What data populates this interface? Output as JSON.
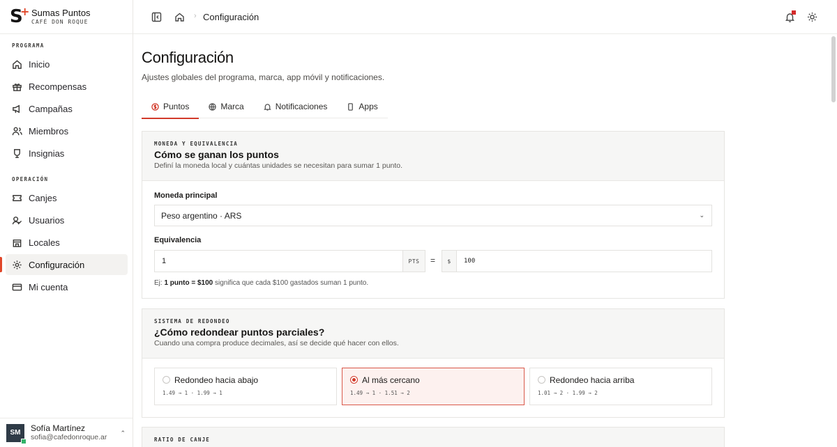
{
  "brand": {
    "name": "Sumas Puntos",
    "subtitle": "CAFÉ DON ROQUE"
  },
  "sidebar": {
    "sections": [
      {
        "label": "PROGRAMA"
      },
      {
        "label": "OPERACIÓN"
      }
    ],
    "items": [
      {
        "label": "Inicio",
        "icon": "home-icon"
      },
      {
        "label": "Recompensas",
        "icon": "gift-icon"
      },
      {
        "label": "Campañas",
        "icon": "megaphone-icon"
      },
      {
        "label": "Miembros",
        "icon": "members-icon"
      },
      {
        "label": "Insignias",
        "icon": "badge-icon"
      },
      {
        "label": "Canjes",
        "icon": "ticket-icon"
      },
      {
        "label": "Usuarios",
        "icon": "users-icon"
      },
      {
        "label": "Locales",
        "icon": "store-icon"
      },
      {
        "label": "Configuración",
        "icon": "gear-icon",
        "active": true
      },
      {
        "label": "Mi cuenta",
        "icon": "card-icon"
      }
    ]
  },
  "user": {
    "initials": "SM",
    "name": "Sofía Martínez",
    "email": "sofia@cafedonroque.ar"
  },
  "topbar": {
    "breadcrumb_current": "Configuración"
  },
  "page": {
    "title": "Configuración",
    "subtitle": "Ajustes globales del programa, marca, app móvil y notificaciones."
  },
  "tabs": [
    {
      "label": "Puntos",
      "icon": "coin-icon",
      "active": true
    },
    {
      "label": "Marca",
      "icon": "globe-icon"
    },
    {
      "label": "Notificaciones",
      "icon": "bell-icon"
    },
    {
      "label": "Apps",
      "icon": "phone-icon"
    }
  ],
  "currency_card": {
    "eyebrow": "MONEDA Y EQUIVALENCIA",
    "title": "Cómo se ganan los puntos",
    "description": "Definí la moneda local y cuántas unidades se necesitan para sumar 1 punto.",
    "currency_label": "Moneda principal",
    "currency_value": "Peso argentino · ARS",
    "equivalence_label": "Equivalencia",
    "points_value": "1",
    "points_unit": "PTS",
    "equals": "=",
    "currency_symbol": "$",
    "amount_value": "100",
    "hint_prefix": "Ej: ",
    "hint_bold": "1 punto = $100",
    "hint_suffix": " significa que cada $100 gastados suman 1 punto."
  },
  "rounding_card": {
    "eyebrow": "SISTEMA DE REDONDEO",
    "title": "¿Cómo redondear puntos parciales?",
    "description": "Cuando una compra produce decimales, así se decide qué hacer con ellos.",
    "options": [
      {
        "label": "Redondeo hacia abajo",
        "example": "1.49 → 1 · 1.99 → 1",
        "selected": false
      },
      {
        "label": "Al más cercano",
        "example": "1.49 → 1 · 1.51 → 2",
        "selected": true
      },
      {
        "label": "Redondeo hacia arriba",
        "example": "1.01 → 2 · 1.99 → 2",
        "selected": false
      }
    ]
  },
  "ratio_card": {
    "eyebrow": "RATIO DE CANJE"
  }
}
